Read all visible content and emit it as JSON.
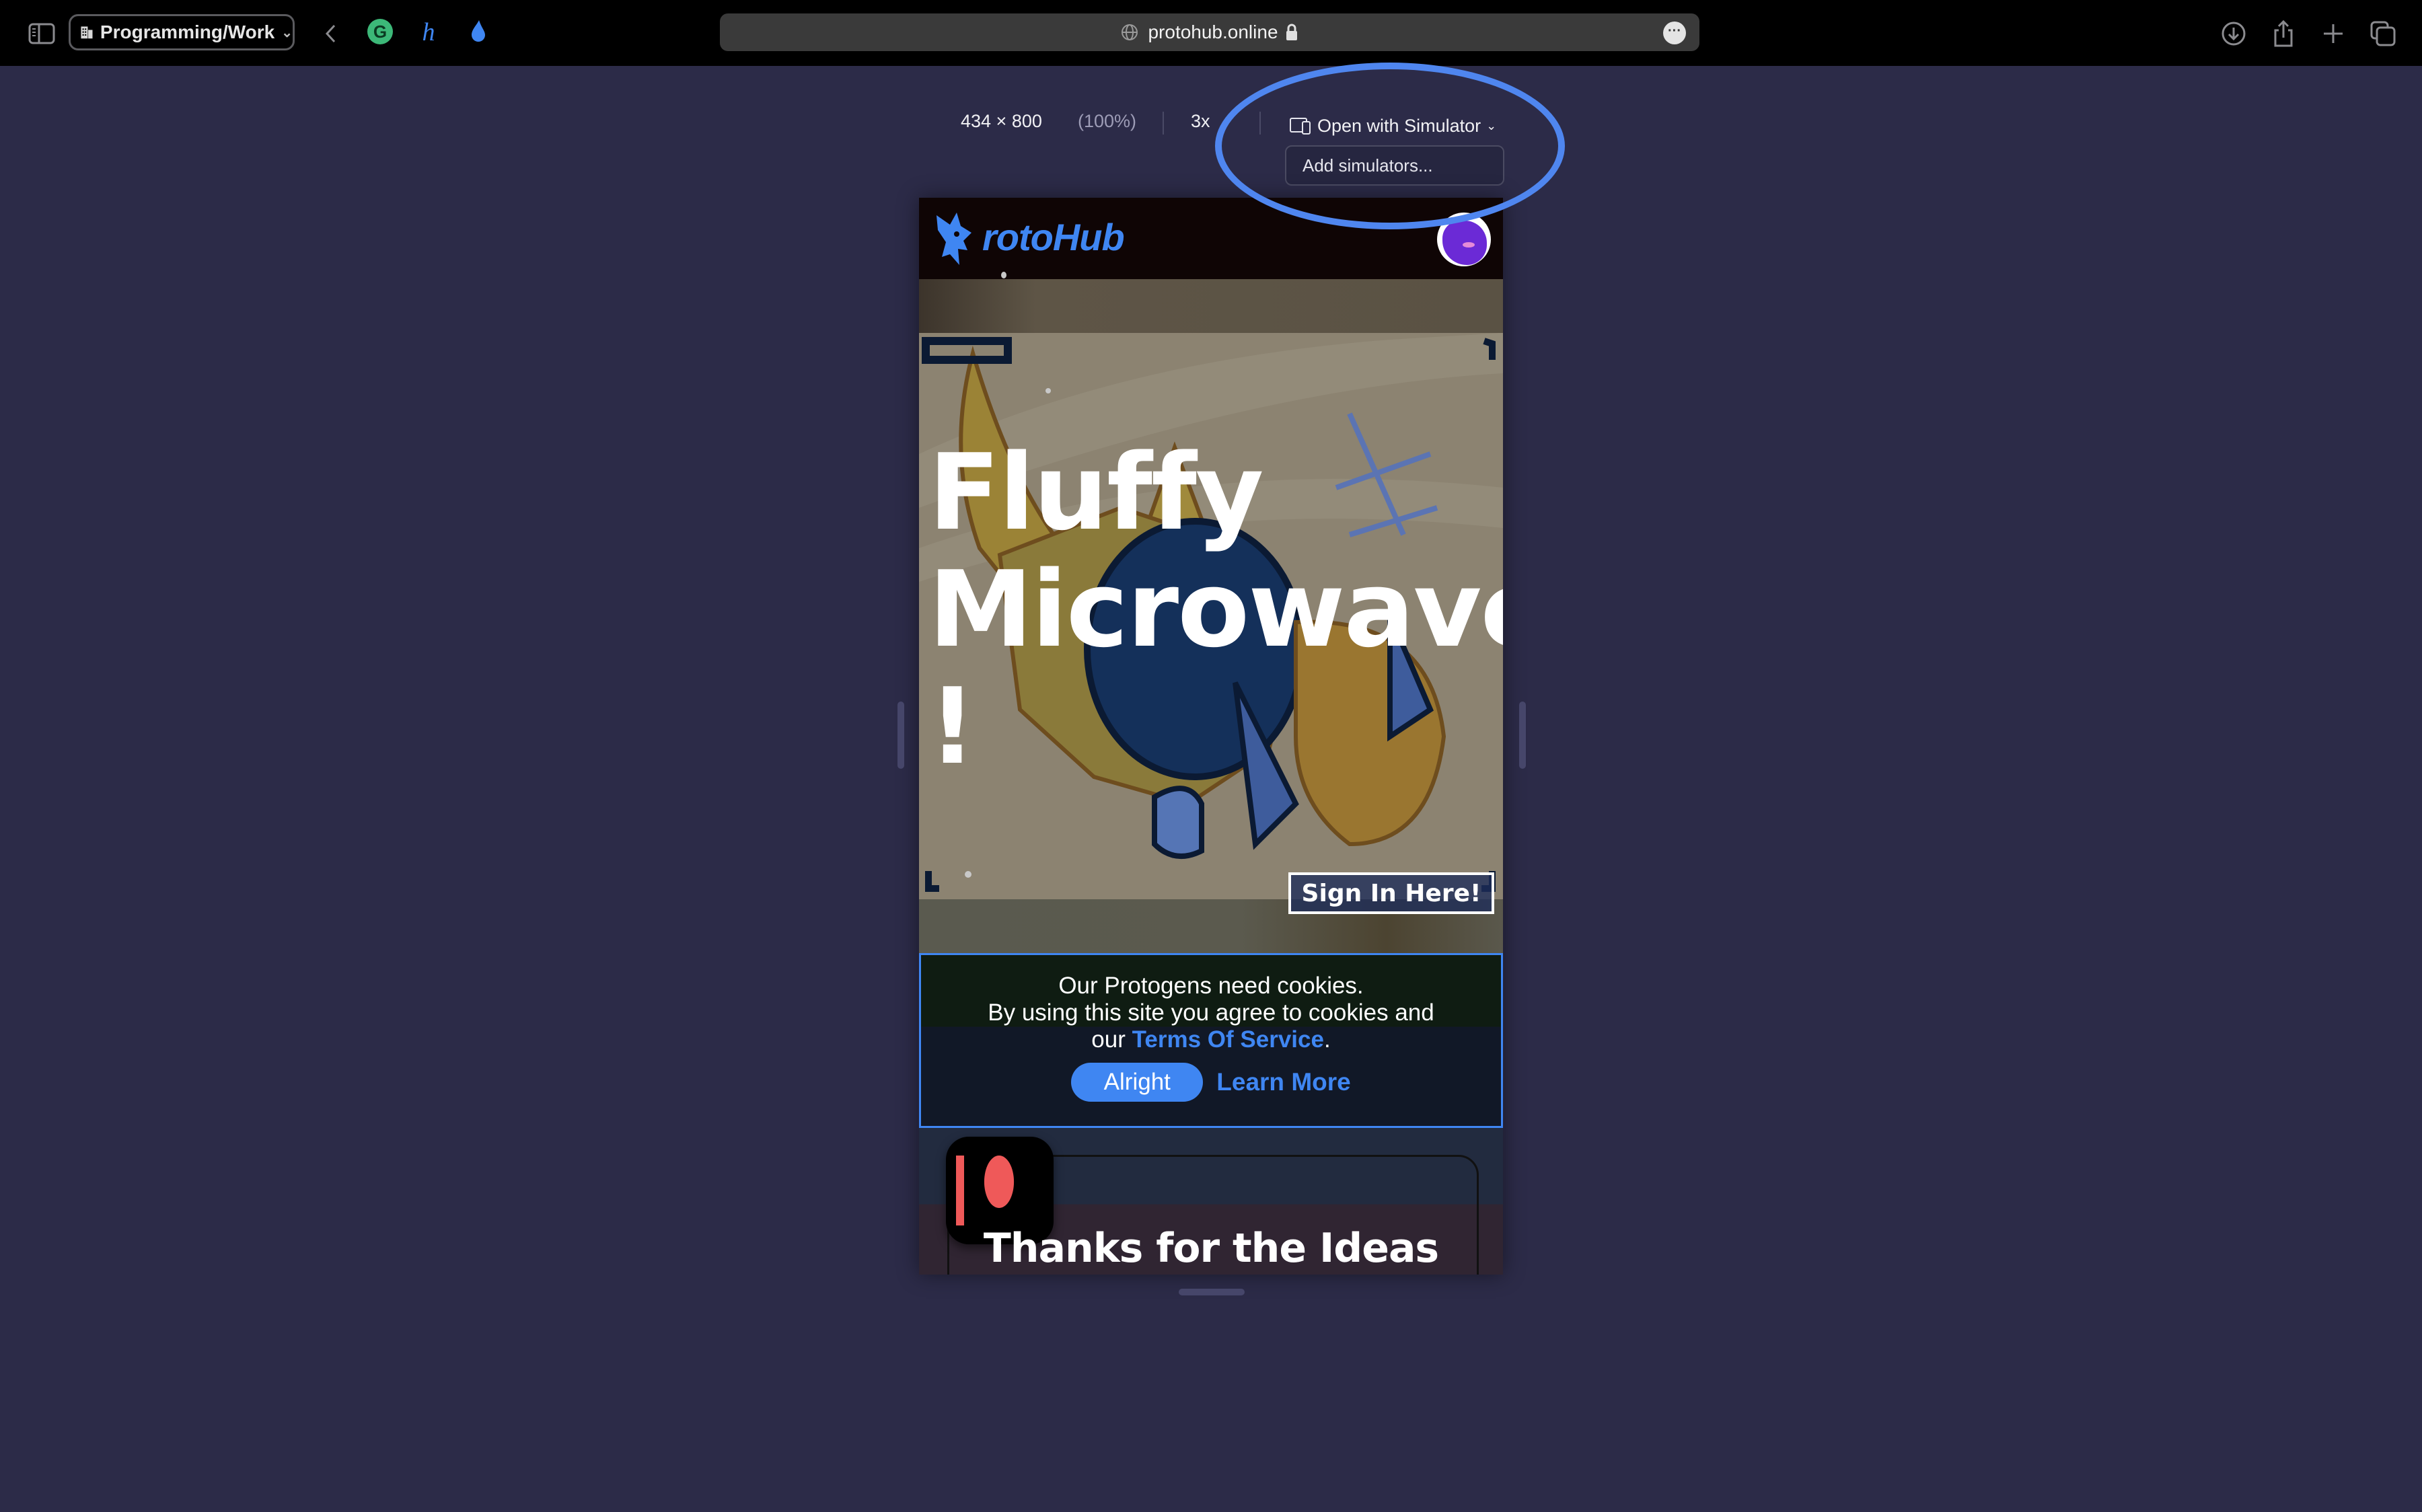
{
  "browser": {
    "tab_group_label": "Programming/Work",
    "url": "protohub.online",
    "icons": {
      "sidebar": "sidebar-toggle-icon",
      "tab_group": "building-icon",
      "back": "chevron-left-icon",
      "extensions": [
        "grammarly-icon",
        "h-extension-icon",
        "blue-drop-extension-icon"
      ],
      "right": [
        "download-icon",
        "share-icon",
        "new-tab-plus-icon",
        "tabs-overview-icon"
      ]
    }
  },
  "device_toolbar": {
    "dimensions": "434 × 800",
    "zoom": "(100%)",
    "pixel_ratio": "3x",
    "simulator_button": "Open with Simulator",
    "simulator_menu_item": "Add simulators..."
  },
  "site": {
    "brand": "rotoHub",
    "brand_full": "ProtoHub",
    "hero_title_line1": "Fluffy",
    "hero_title_line2": "Microwaves",
    "hero_title_line3": "!",
    "sign_in": "Sign In Here!",
    "cookie": {
      "line1": "Our Protogens need cookies.",
      "line2": "By using this site you agree to cookies and",
      "line3_prefix": "our ",
      "tos_link": "Terms Of Service",
      "line3_suffix": ".",
      "accept": "Alright",
      "learn_more": "Learn More"
    },
    "card_title": "Thanks for the Ideas"
  },
  "colors": {
    "accent": "#3f86f2",
    "highlight_ring": "#4f86ef",
    "patreon": "#ef5959",
    "page_bg": "#2c2b48"
  }
}
